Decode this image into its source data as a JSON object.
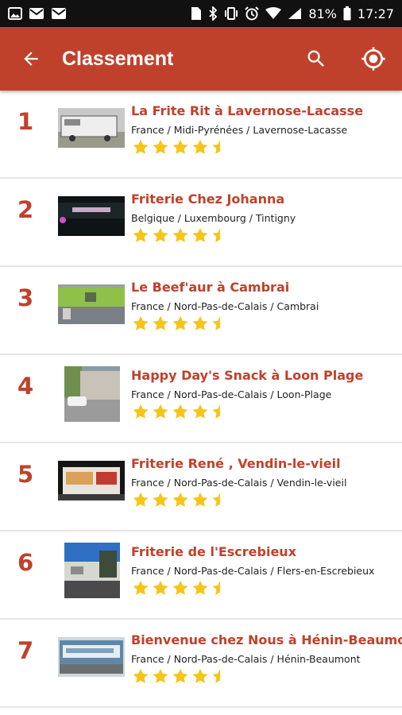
{
  "status_bar": {
    "battery": "81%",
    "time": "17:27",
    "notification_icons": [
      "image-icon",
      "mail-icon",
      "mail-icon"
    ],
    "system_icons": [
      "sim-icon",
      "bluetooth-icon",
      "vibrate-icon",
      "alarm-icon",
      "wifi-icon",
      "signal-icon",
      "battery-icon"
    ]
  },
  "app_bar": {
    "title": "Classement",
    "color": "#c0412b",
    "icons": [
      "back-arrow-icon",
      "search-icon",
      "my-location-icon"
    ]
  },
  "colors": {
    "accent": "#c0412b",
    "star": "#f5c518"
  },
  "ranking": [
    {
      "rank": "1",
      "name": "La Frite Rit à Lavernose-Lacasse",
      "location": "France / Midi-Pyrénées / Lavernose-Lacasse",
      "rating": 4.5
    },
    {
      "rank": "2",
      "name": "Friterie Chez Johanna",
      "location": "Belgique / Luxembourg / Tintigny",
      "rating": 4.5
    },
    {
      "rank": "3",
      "name": "Le Beef'aur à Cambrai",
      "location": "France / Nord-Pas-de-Calais / Cambrai",
      "rating": 4.5
    },
    {
      "rank": "4",
      "name": "Happy Day's Snack à Loon Plage",
      "location": "France / Nord-Pas-de-Calais / Loon-Plage",
      "rating": 4.5
    },
    {
      "rank": "5",
      "name": "Friterie René , Vendin-le-vieil",
      "location": "France / Nord-Pas-de-Calais / Vendin-le-vieil",
      "rating": 4.5
    },
    {
      "rank": "6",
      "name": "Friterie de l'Escrebieux",
      "location": "France / Nord-Pas-de-Calais / Flers-en-Escrebieux",
      "rating": 4.5
    },
    {
      "rank": "7",
      "name": "Bienvenue chez Nous à Hénin-Beaumont",
      "location": "France / Nord-Pas-de-Calais / Hénin-Beaumont",
      "rating": 4.5
    }
  ]
}
